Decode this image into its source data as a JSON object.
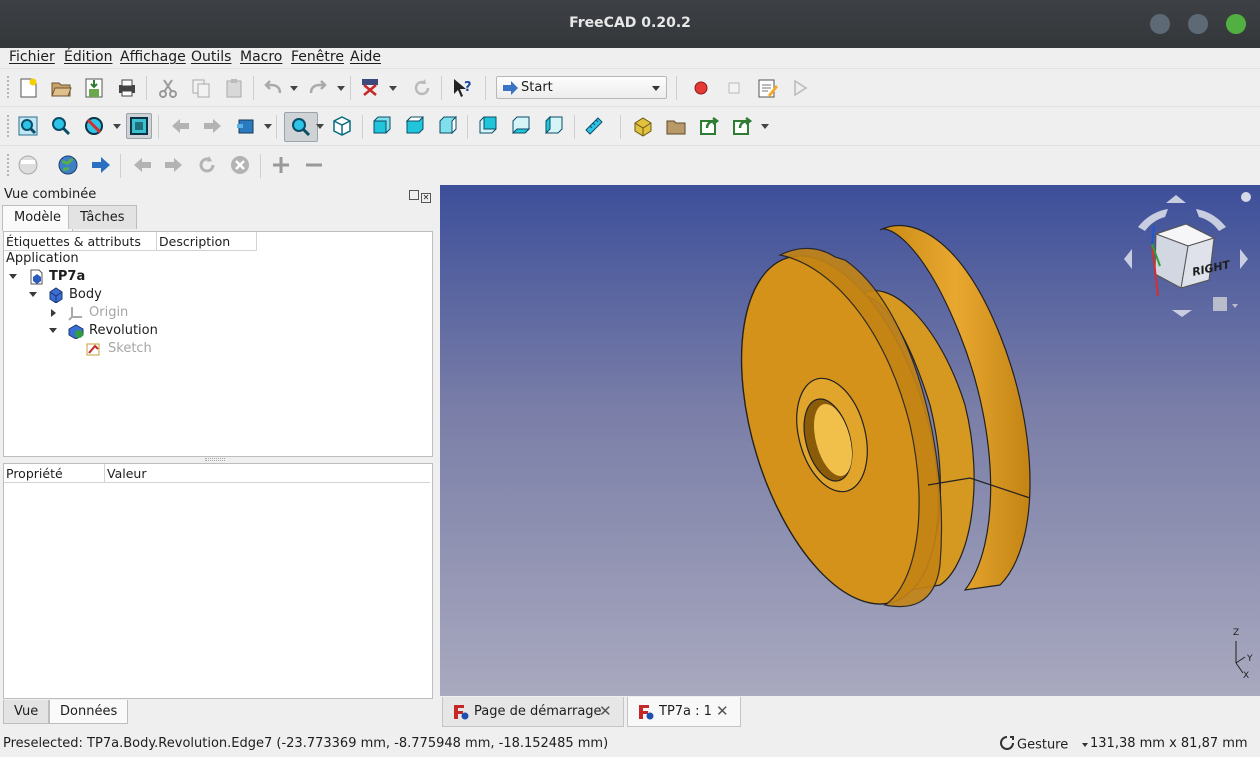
{
  "window": {
    "title": "FreeCAD 0.20.2"
  },
  "menu": [
    "Fichier",
    "Édition",
    "Affichage",
    "Outils",
    "Macro",
    "Fenêtre",
    "Aide"
  ],
  "toolbar": {
    "workbench": "Start"
  },
  "combo_view": {
    "title": "Vue combinée",
    "tabs": [
      "Modèle",
      "Tâches"
    ],
    "tree_headers": [
      "Étiquettes & attributs",
      "Description"
    ],
    "tree": {
      "root": "Application",
      "document": "TP7a",
      "body": "Body",
      "origin": "Origin",
      "revolution": "Revolution",
      "sketch": "Sketch"
    },
    "property_headers": [
      "Propriété",
      "Valeur"
    ],
    "bottom_tabs": [
      "Vue",
      "Données"
    ]
  },
  "navcube": {
    "face_label": "RIGHT"
  },
  "axis": {
    "x": "X",
    "y": "Y",
    "z": "Z"
  },
  "doc_tabs": [
    "Page de démarrage",
    "TP7a : 1"
  ],
  "status": {
    "preselected": "Preselected: TP7a.Body.Revolution.Edge7 (-23.773369 mm, -8.775948 mm, -18.152485 mm)",
    "navigation": "Gesture",
    "dimensions": "131,38 mm x 81,87 mm"
  },
  "colors": {
    "part": "#d89a1c",
    "view_top": "#3d4f9a",
    "view_bottom": "#a9a9bf"
  }
}
